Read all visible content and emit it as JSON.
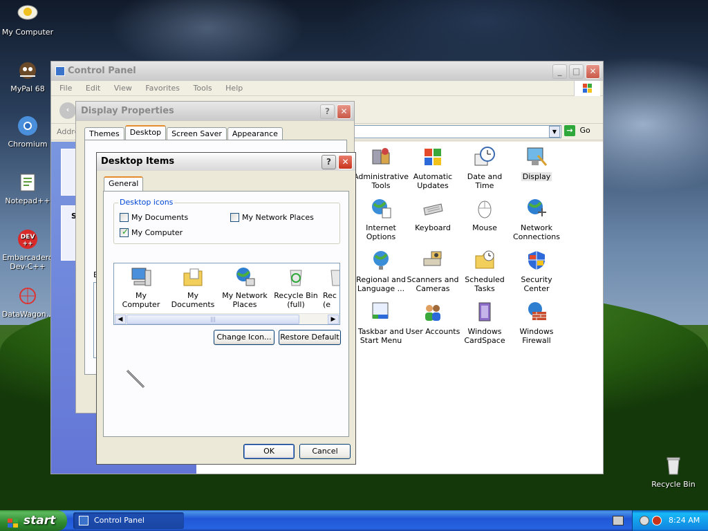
{
  "desktop": {
    "icons": [
      {
        "label": "My Computer"
      },
      {
        "label": "MyPal 68"
      },
      {
        "label": "Chromium"
      },
      {
        "label": "Notepad++"
      },
      {
        "label": "Embarcadero Dev-C++"
      },
      {
        "label": "DataWagon..."
      },
      {
        "label": "Recycle Bin"
      }
    ]
  },
  "control_panel": {
    "title": "Control Panel",
    "menu": [
      "File",
      "Edit",
      "View",
      "Favorites",
      "Tools",
      "Help"
    ],
    "address_label": "Addre",
    "go_label": "Go",
    "items": [
      {
        "label": "Administrative Tools",
        "icon": "admin-tools-icon"
      },
      {
        "label": "Automatic Updates",
        "icon": "windows-logo-icon"
      },
      {
        "label": "Date and Time",
        "icon": "clock-icon"
      },
      {
        "label": "Display",
        "icon": "display-icon",
        "selected": true
      },
      {
        "label": "Internet Options",
        "icon": "globe-icon"
      },
      {
        "label": "Keyboard",
        "icon": "keyboard-icon"
      },
      {
        "label": "Mouse",
        "icon": "mouse-icon"
      },
      {
        "label": "Network Connections",
        "icon": "network-icon"
      },
      {
        "label": "Regional and Language ...",
        "icon": "globe-icon"
      },
      {
        "label": "Scanners and Cameras",
        "icon": "scanner-icon"
      },
      {
        "label": "Scheduled Tasks",
        "icon": "folder-clock-icon"
      },
      {
        "label": "Security Center",
        "icon": "shield-icon"
      },
      {
        "label": "Taskbar and Start Menu",
        "icon": "taskbar-icon"
      },
      {
        "label": "User Accounts",
        "icon": "users-icon"
      },
      {
        "label": "Windows CardSpace",
        "icon": "cardspace-icon"
      },
      {
        "label": "Windows Firewall",
        "icon": "firewall-icon"
      }
    ],
    "side_letters": {
      "s": "S",
      "b": "B"
    }
  },
  "display_properties": {
    "title": "Display Properties",
    "tabs": [
      "Themes",
      "Desktop",
      "Screen Saver",
      "Appearance"
    ],
    "selected_tab": "Desktop"
  },
  "desktop_items": {
    "title": "Desktop Items",
    "tab": "General",
    "group_label": "Desktop icons",
    "checkboxes": [
      {
        "label": "My Documents",
        "checked": false
      },
      {
        "label": "My Network Places",
        "checked": false
      },
      {
        "label": "My Computer",
        "checked": true
      }
    ],
    "icon_list": [
      {
        "label": "My Computer"
      },
      {
        "label": "My Documents"
      },
      {
        "label": "My Network Places"
      },
      {
        "label": "Recycle Bin (full)"
      },
      {
        "label": "Rec (e"
      }
    ],
    "change_icon_label": "Change Icon...",
    "restore_default_label": "Restore Default",
    "ok_label": "OK",
    "cancel_label": "Cancel"
  },
  "taskbar": {
    "start_label": "start",
    "task_label": "Control Panel",
    "clock": "8:24 AM"
  }
}
